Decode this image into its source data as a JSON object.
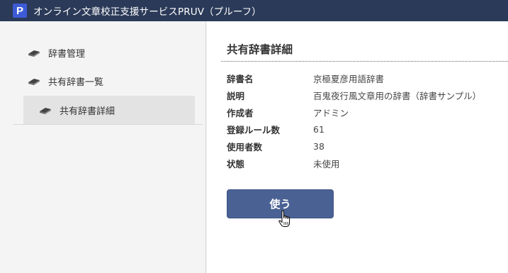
{
  "app": {
    "logo_letter": "P",
    "title": "オンライン文章校正支援サービスPRUV（プルーフ）"
  },
  "sidebar": {
    "items": [
      {
        "label": "辞書管理",
        "icon": "book-icon"
      },
      {
        "label": "共有辞書一覧",
        "icon": "book-icon"
      },
      {
        "label": "共有辞書詳細",
        "icon": "book-icon",
        "active": true
      }
    ]
  },
  "main": {
    "title": "共有辞書詳細",
    "details": [
      {
        "label": "辞書名",
        "value": "京極夏彦用語辞書"
      },
      {
        "label": "説明",
        "value": "百鬼夜行風文章用の辞書（辞書サンプル）"
      },
      {
        "label": "作成者",
        "value": "アドミン"
      },
      {
        "label": "登録ルール数",
        "value": "61"
      },
      {
        "label": "使用者数",
        "value": "38"
      },
      {
        "label": "状態",
        "value": "未使用"
      }
    ],
    "use_button_label": "使う"
  },
  "colors": {
    "titlebar": "#2b3a58",
    "logo": "#3d5bd6",
    "button": "#4a6194",
    "active_item": "#e3e3e3"
  }
}
